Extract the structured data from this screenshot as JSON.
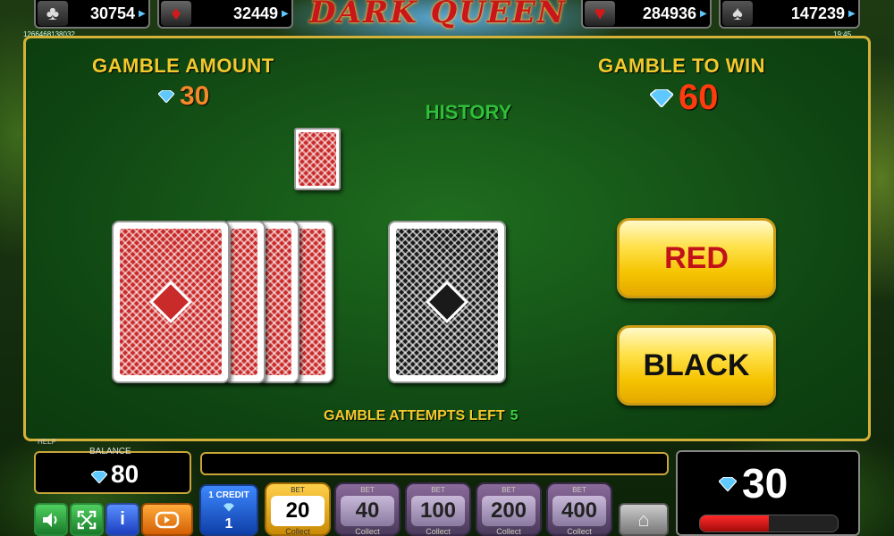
{
  "jackpots": [
    {
      "suit": "♣",
      "value": "30754",
      "red": false
    },
    {
      "suit": "♦",
      "value": "32449",
      "red": true
    },
    {
      "suit": "♥",
      "value": "284936",
      "red": true
    },
    {
      "suit": "♠",
      "value": "147239",
      "red": false
    }
  ],
  "logo": "DARK QUEEN",
  "tiny_left": "1266468138032",
  "tiny_right": "19:45",
  "gamble": {
    "amount_label": "GAMBLE AMOUNT",
    "amount_value": "30",
    "to_win_label": "GAMBLE TO WIN",
    "to_win_value": "60",
    "history_label": "HISTORY",
    "red_label": "RED",
    "black_label": "BLACK",
    "attempts_label": "GAMBLE ATTEMPTS LEFT",
    "attempts_value": "5"
  },
  "bottom": {
    "help_label": "HELP",
    "balance_label": "BALANCE",
    "balance_value": "80",
    "win_value": "30",
    "win_bar_fraction": 0.5,
    "credit_label": "1 CREDIT",
    "credit_value": "1",
    "bet_label": "BET",
    "collect_label": "Collect",
    "bets": [
      "20",
      "40",
      "100",
      "200",
      "400"
    ]
  },
  "colors": {
    "accent_gold": "#f2c92e",
    "felt": "#1f6d1f",
    "win_red": "#ff3b0f",
    "amount_orange": "#f7882a"
  }
}
